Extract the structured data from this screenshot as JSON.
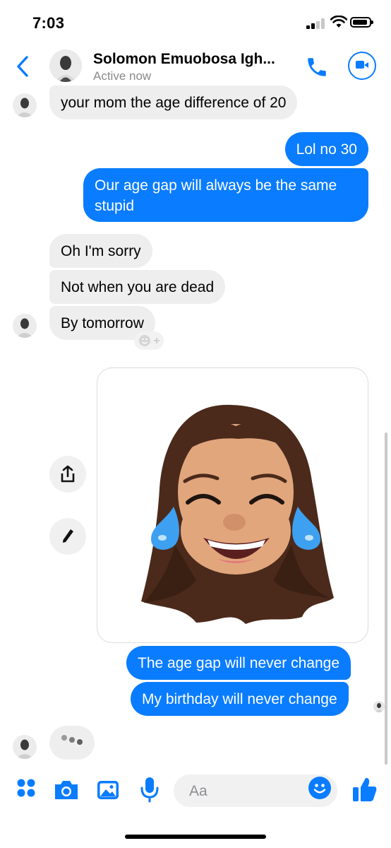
{
  "status_bar": {
    "time": "7:03"
  },
  "header": {
    "contact_name": "Solomon Emuobosa Igh...",
    "status": "Active now"
  },
  "messages": [
    {
      "side": "in",
      "text": "your mom the age difference of 20"
    },
    {
      "side": "out",
      "text": "Lol no 30"
    },
    {
      "side": "out",
      "lines": [
        "Our age gap will always be the same",
        "stupid"
      ]
    },
    {
      "side": "in",
      "text": "Oh I'm sorry"
    },
    {
      "side": "in",
      "text": "Not when you are dead"
    },
    {
      "side": "in",
      "text": "By tomorrow"
    },
    {
      "side": "out",
      "type": "memoji-sticker"
    },
    {
      "side": "out",
      "text": "The age gap will never change"
    },
    {
      "side": "out",
      "text": "My birthday will never change"
    }
  ],
  "composer": {
    "placeholder": "Aa"
  },
  "icons": {
    "back": "chevron-left-icon",
    "call": "phone-icon",
    "video": "video-camera-icon",
    "menu": "four-dots-icon",
    "camera": "camera-icon",
    "gallery": "photo-icon",
    "mic": "microphone-icon",
    "emoji": "smiley-icon",
    "like": "thumbs-up-icon",
    "share": "share-icon",
    "edit": "pencil-icon"
  },
  "colors": {
    "accent": "#0a7cff",
    "incoming_bubble": "#eeeeef",
    "secondary_text": "#8a8a8a"
  }
}
